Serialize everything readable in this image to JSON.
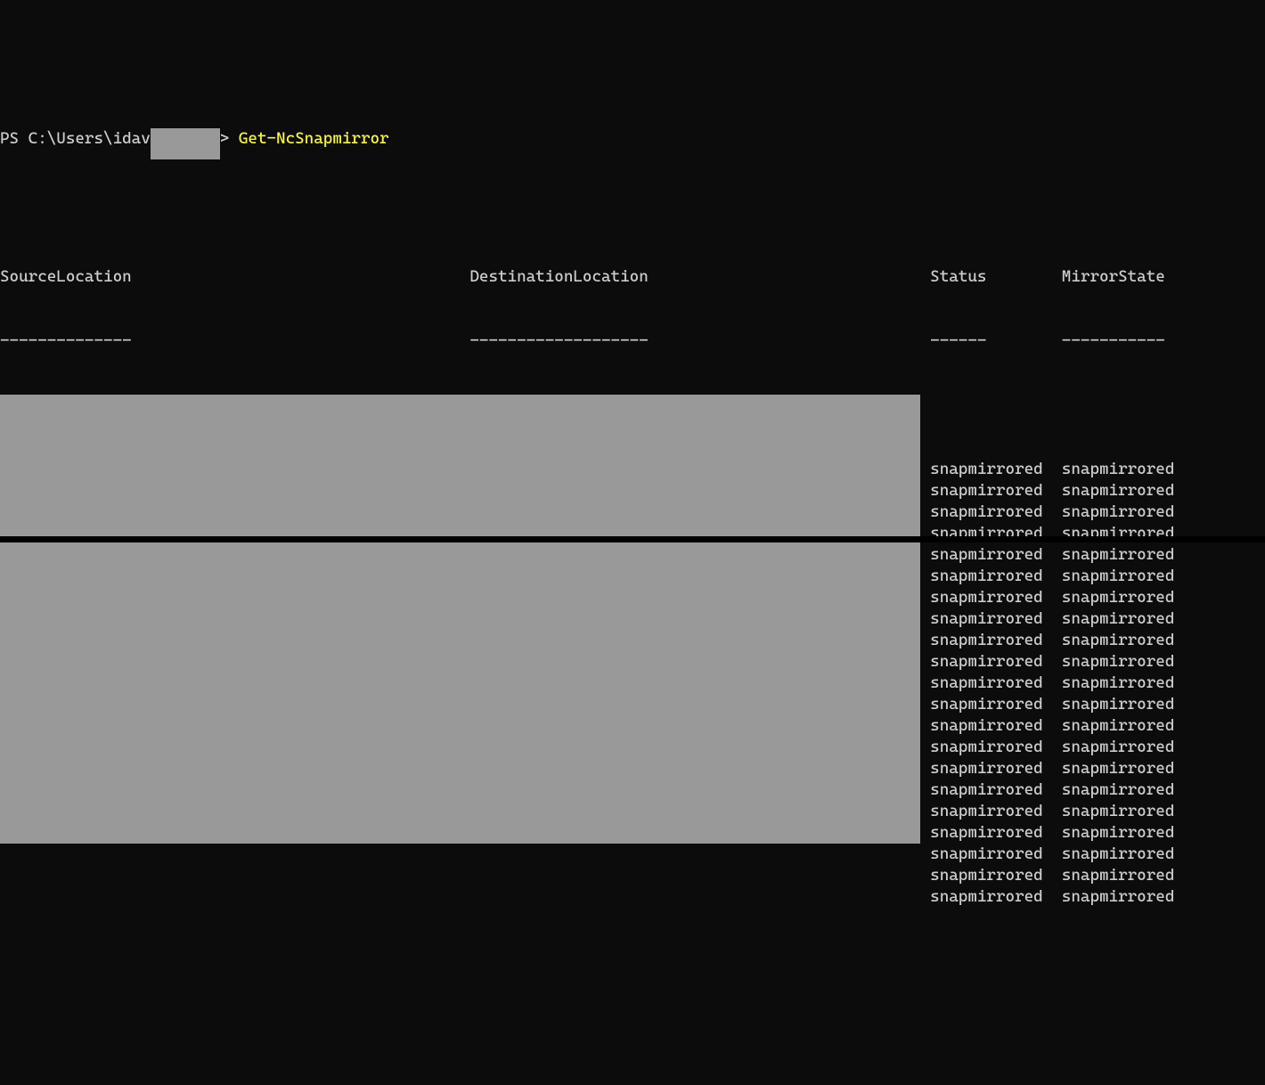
{
  "prompt": {
    "prefix": "PS C:\\Users\\idav",
    "suffix": "> ",
    "command": "Get-NcSnapmirror"
  },
  "headers": {
    "col1": "SourceLocation",
    "col2": "DestinationLocation",
    "col3": "Status",
    "col4": "MirrorState"
  },
  "underlines": {
    "col1": "--------------",
    "col2": "-------------------",
    "col3": "------",
    "col4": "-----------"
  },
  "rows": [
    {
      "status": "snapmirrored",
      "mirrorstate": "snapmirrored"
    },
    {
      "status": "snapmirrored",
      "mirrorstate": "snapmirrored"
    },
    {
      "status": "snapmirrored",
      "mirrorstate": "snapmirrored"
    },
    {
      "status": "snapmirrored",
      "mirrorstate": "snapmirrored"
    },
    {
      "status": "snapmirrored",
      "mirrorstate": "snapmirrored"
    },
    {
      "status": "snapmirrored",
      "mirrorstate": "snapmirrored"
    },
    {
      "status": "snapmirrored",
      "mirrorstate": "snapmirrored"
    },
    {
      "status": "snapmirrored",
      "mirrorstate": "snapmirrored"
    },
    {
      "status": "snapmirrored",
      "mirrorstate": "snapmirrored"
    },
    {
      "status": "snapmirrored",
      "mirrorstate": "snapmirrored"
    },
    {
      "status": "snapmirrored",
      "mirrorstate": "snapmirrored"
    },
    {
      "status": "snapmirrored",
      "mirrorstate": "snapmirrored"
    },
    {
      "status": "snapmirrored",
      "mirrorstate": "snapmirrored"
    },
    {
      "status": "snapmirrored",
      "mirrorstate": "snapmirrored"
    },
    {
      "status": "snapmirrored",
      "mirrorstate": "snapmirrored"
    },
    {
      "status": "snapmirrored",
      "mirrorstate": "snapmirrored"
    },
    {
      "status": "snapmirrored",
      "mirrorstate": "snapmirrored"
    },
    {
      "status": "snapmirrored",
      "mirrorstate": "snapmirrored"
    },
    {
      "status": "snapmirrored",
      "mirrorstate": "snapmirrored"
    },
    {
      "status": "snapmirrored",
      "mirrorstate": "snapmirrored"
    },
    {
      "status": "snapmirrored",
      "mirrorstate": "snapmirrored"
    }
  ],
  "layout": {
    "col1_pad": 0,
    "col2_pad": 50,
    "col3_pad": 99,
    "col4_pad": 113
  }
}
